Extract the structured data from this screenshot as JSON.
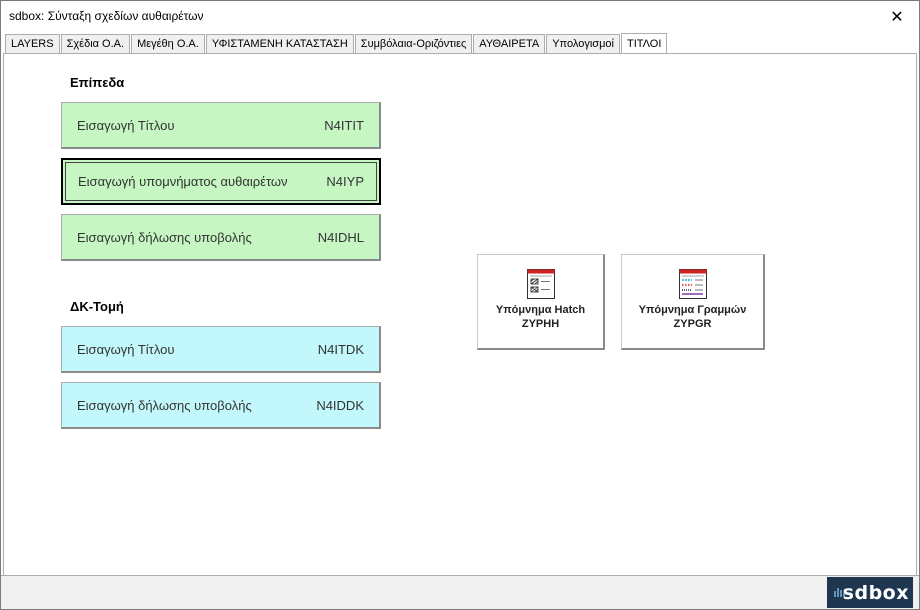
{
  "window": {
    "title": "sdbox: Σύνταξη σχεδίων αυθαιρέτων",
    "close_glyph": "✕"
  },
  "tabs": [
    {
      "label": "LAYERS"
    },
    {
      "label": "Σχέδια Ο.Α."
    },
    {
      "label": "Μεγέθη Ο.Α."
    },
    {
      "label": "ΥΦΙΣΤΑΜΕΝΗ ΚΑΤΑΣΤΑΣΗ"
    },
    {
      "label": "Συμβόλαια-Οριζόντιες"
    },
    {
      "label": "ΑΥΘΑΙΡΕΤΑ"
    },
    {
      "label": "Υπολογισμοί"
    },
    {
      "label": "ΤΙΤΛΟΙ",
      "active": true
    }
  ],
  "epipeda": {
    "title": "Επίπεδα",
    "buttons": [
      {
        "label": "Εισαγωγή Τίτλου",
        "code": "N4ITIT"
      },
      {
        "label": "Εισαγωγή υπομνήματος αυθαιρέτων",
        "code": "N4IYP"
      },
      {
        "label": "Εισαγωγή δήλωσης υποβολής",
        "code": "N4IDHL"
      }
    ]
  },
  "dktomi": {
    "title": "ΔΚ-Τομή",
    "buttons": [
      {
        "label": "Εισαγωγή Τίτλου",
        "code": "N4ITDK"
      },
      {
        "label": "Εισαγωγή δήλωσης υποβολής",
        "code": "N4IDDK"
      }
    ]
  },
  "legends": [
    {
      "line1": "Υπόμνημα Hatch",
      "line2": "ZYPHH",
      "icon": "hatch-legend-icon"
    },
    {
      "line1": "Υπόμνημα Γραμμών",
      "line2": "ZYPGR",
      "icon": "lines-legend-icon"
    }
  ],
  "logo": {
    "text": "sdbox"
  },
  "colors": {
    "green_button": "#c6f7c2",
    "cyan_button": "#c2f8fb",
    "logo_bg": "#1e3650"
  }
}
